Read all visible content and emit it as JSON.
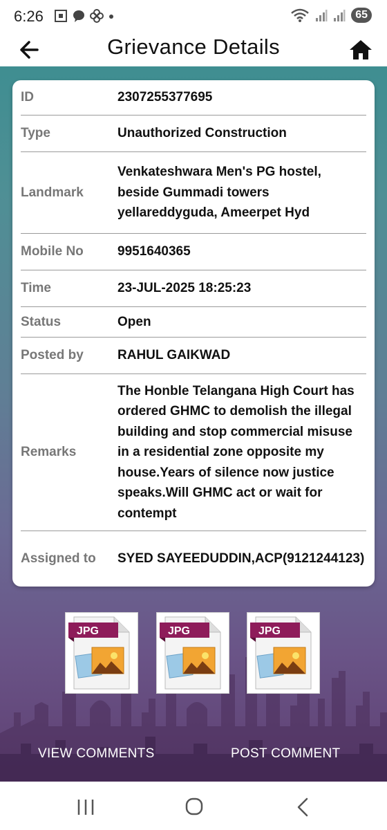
{
  "status_bar": {
    "time": "6:26",
    "battery": "65",
    "left_icons": [
      "screenshot-icon",
      "messenger-icon",
      "pinwheel-icon",
      "dot-icon"
    ],
    "right_icons": [
      "wifi-icon",
      "signal-icon",
      "signal-icon"
    ]
  },
  "app_bar": {
    "title": "Grievance Details",
    "back_icon": "back-arrow-icon",
    "home_icon": "home-icon"
  },
  "details": {
    "id": {
      "label": "ID",
      "value": "2307255377695"
    },
    "type": {
      "label": "Type",
      "value": "Unauthorized Construction"
    },
    "landmark": {
      "label": "Landmark",
      "value": "Venkateshwara Men's PG hostel, beside Gummadi towers yellareddyguda, Ameerpet Hyd"
    },
    "mobile": {
      "label": "Mobile No",
      "value": "9951640365"
    },
    "time": {
      "label": "Time",
      "value": "23-JUL-2025 18:25:23"
    },
    "status": {
      "label": "Status",
      "value": "Open"
    },
    "posted_by": {
      "label": "Posted by",
      "value": "RAHUL GAIKWAD"
    },
    "remarks": {
      "label": "Remarks",
      "value": "The Honble Telangana High Court has ordered GHMC to demolish the illegal building and stop commercial misuse in a residential zone opposite my house.Years of silence now justice speaks.Will GHMC act or wait for contempt"
    },
    "assigned": {
      "label": "Assigned to",
      "value": "SYED SAYEEDUDDIN,ACP(9121244123)"
    }
  },
  "attachments": [
    {
      "badge": "JPG"
    },
    {
      "badge": "JPG"
    },
    {
      "badge": "JPG"
    }
  ],
  "actions": {
    "view_comments": "VIEW COMMENTS",
    "post_comment": "POST COMMENT"
  },
  "colors": {
    "card_bg": "#ffffff",
    "label": "#777777",
    "value": "#111111",
    "jpg_badge": "#8e1c5a",
    "bg_top": "#3f8e91",
    "bg_bottom": "#5e3f72"
  }
}
